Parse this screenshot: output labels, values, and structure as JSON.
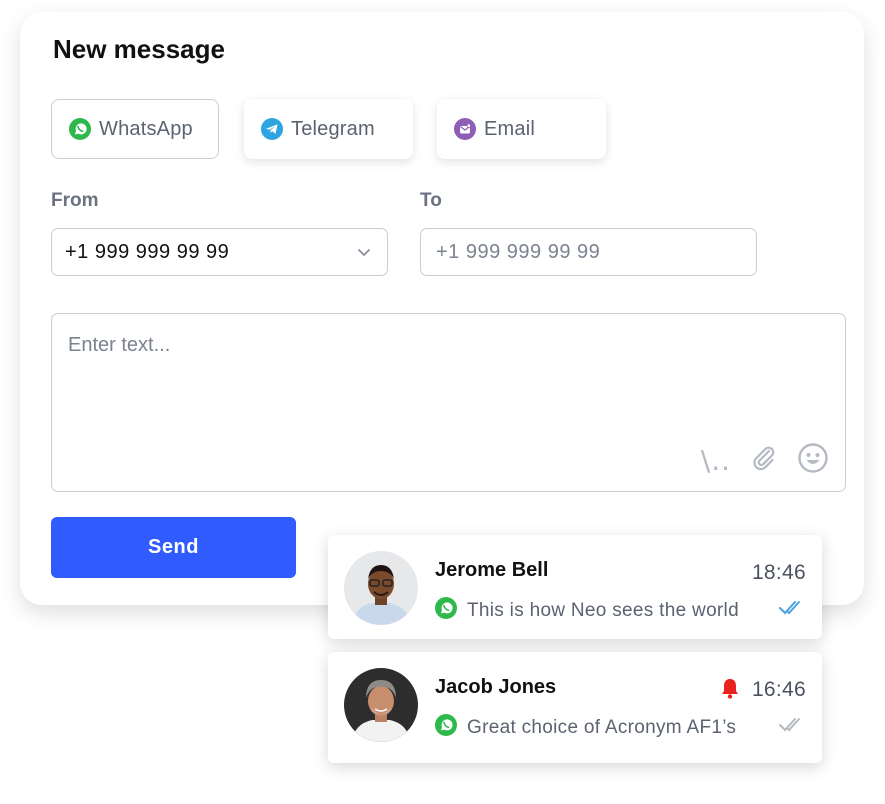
{
  "header": {
    "title": "New message"
  },
  "channels": [
    {
      "label": "WhatsApp",
      "icon": "whatsapp-icon",
      "active": true,
      "color": "#2fb84c"
    },
    {
      "label": "Telegram",
      "icon": "telegram-icon",
      "active": false,
      "color": "#2ea4e3"
    },
    {
      "label": "Email",
      "icon": "email-icon",
      "active": false,
      "color": "#8e5db5"
    }
  ],
  "from": {
    "label": "From",
    "value": "+1 999 999 99 99"
  },
  "to": {
    "label": "To",
    "placeholder": "+1 999 999 99 99"
  },
  "compose": {
    "placeholder": "Enter text...",
    "template_symbol": "\\..",
    "tools": [
      "slash-template-icon",
      "paperclip-icon",
      "emoji-icon"
    ]
  },
  "send_label": "Send",
  "conversations": [
    {
      "name": "Jerome Bell",
      "time": "18:46",
      "preview": "This is how Neo sees the world",
      "channel": "whatsapp-icon",
      "status": "read",
      "status_color": "#4aa3df",
      "notify": false
    },
    {
      "name": "Jacob Jones",
      "time": "16:46",
      "preview": "Great choice of Acronym AF1’s",
      "channel": "whatsapp-icon",
      "status": "delivered",
      "status_color": "#b4b9c2",
      "notify": true,
      "notify_color": "#e8231f"
    }
  ],
  "colors": {
    "accent": "#2f5bff",
    "border": "#c9ced6",
    "muted_text": "#5b6270"
  }
}
